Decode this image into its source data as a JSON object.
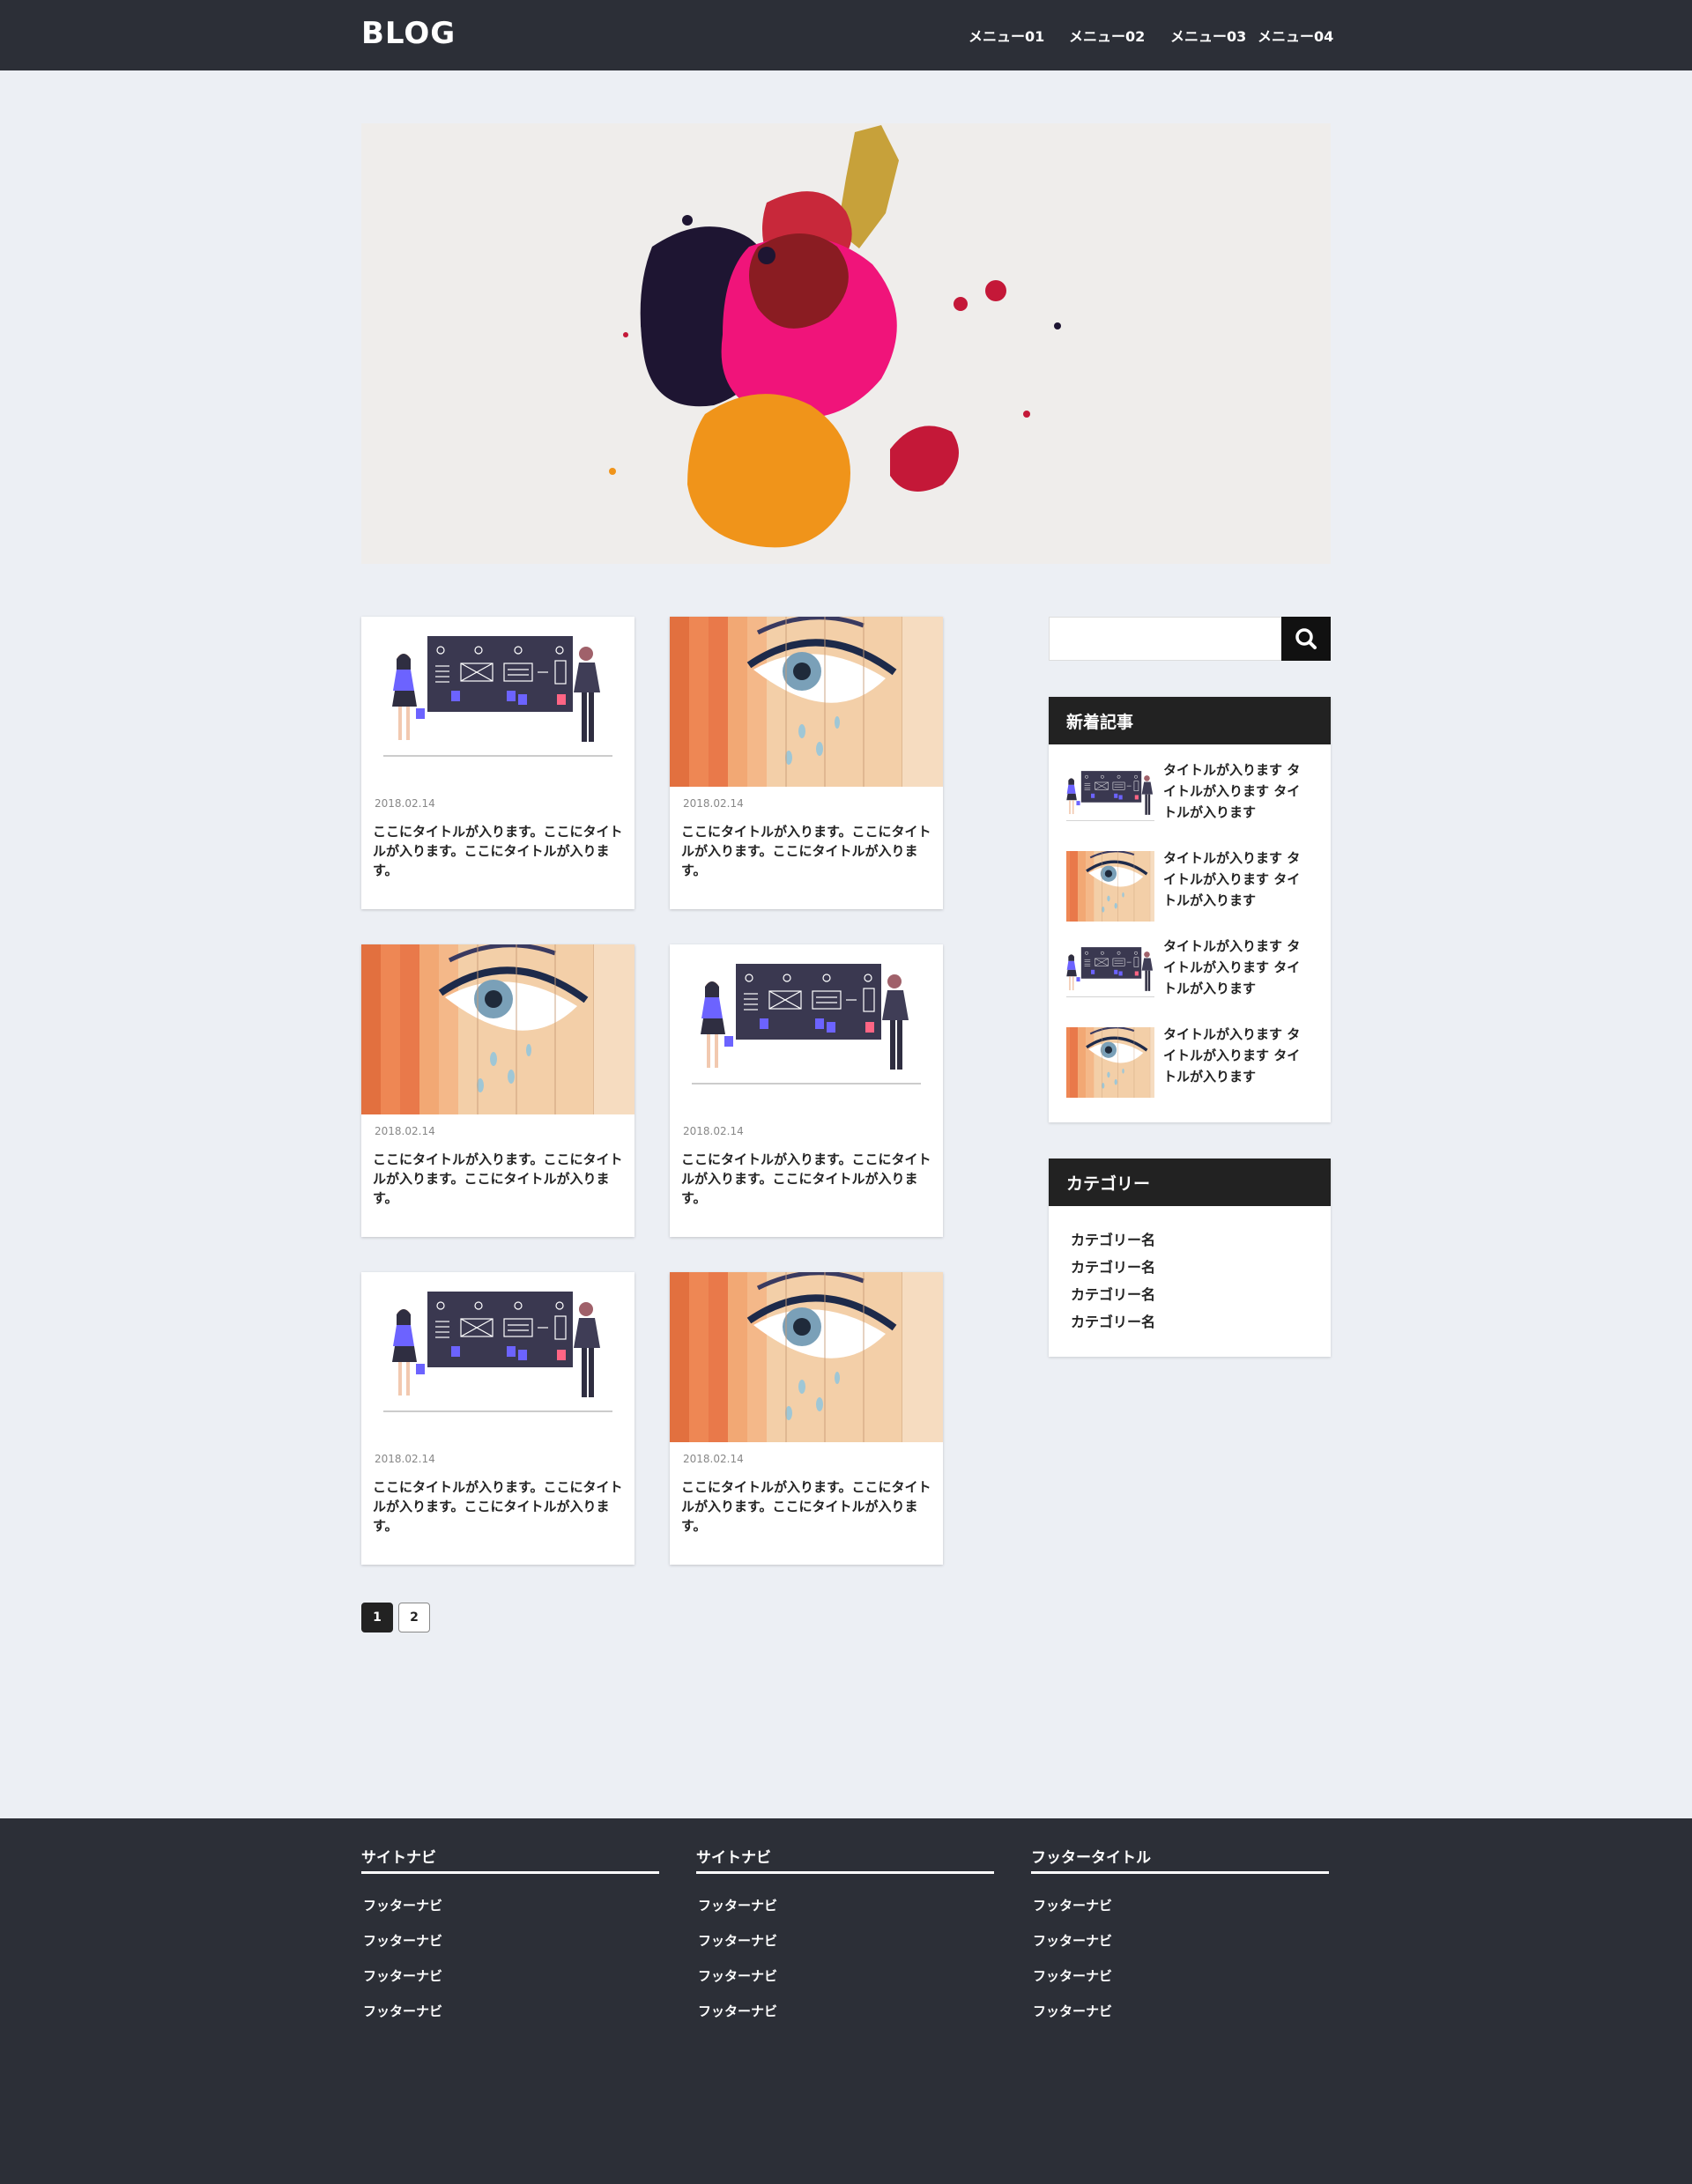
{
  "header": {
    "logo": "BLOG",
    "menu": [
      "メニュー01",
      "メニュー02",
      "メニュー03",
      "メニュー04"
    ]
  },
  "hero": {
    "image": "paint-splash-image"
  },
  "posts": [
    {
      "date": "2018.02.14",
      "title": "ここにタイトルが入ります。ここにタイトルが入ります。ここにタイトルが入ります。",
      "image": "wireframe-presentation-illustration"
    },
    {
      "date": "2018.02.14",
      "title": "ここにタイトルが入ります。ここにタイトルが入ります。ここにタイトルが入ります。",
      "image": "eye-mural-photo"
    },
    {
      "date": "2018.02.14",
      "title": "ここにタイトルが入ります。ここにタイトルが入ります。ここにタイトルが入ります。",
      "image": "eye-mural-photo"
    },
    {
      "date": "2018.02.14",
      "title": "ここにタイトルが入ります。ここにタイトルが入ります。ここにタイトルが入ります。",
      "image": "wireframe-presentation-illustration"
    },
    {
      "date": "2018.02.14",
      "title": "ここにタイトルが入ります。ここにタイトルが入ります。ここにタイトルが入ります。",
      "image": "wireframe-presentation-illustration"
    },
    {
      "date": "2018.02.14",
      "title": "ここにタイトルが入ります。ここにタイトルが入ります。ここにタイトルが入ります。",
      "image": "eye-mural-photo"
    }
  ],
  "pagination": {
    "pages": [
      "1",
      "2"
    ],
    "current": "1"
  },
  "sidebar": {
    "search": {
      "placeholder": "",
      "value": "",
      "icon": "search-icon"
    },
    "recent": {
      "heading": "新着記事",
      "items": [
        {
          "title": "タイトルが入ります タイトルが入ります タイトルが入ります",
          "image": "wireframe-presentation-illustration"
        },
        {
          "title": "タイトルが入ります タイトルが入ります タイトルが入ります",
          "image": "eye-mural-photo"
        },
        {
          "title": "タイトルが入ります タイトルが入ります タイトルが入ります",
          "image": "wireframe-presentation-illustration"
        },
        {
          "title": "タイトルが入ります タイトルが入ります タイトルが入ります",
          "image": "eye-mural-photo"
        }
      ]
    },
    "category": {
      "heading": "カテゴリー",
      "items": [
        "カテゴリー名",
        "カテゴリー名",
        "カテゴリー名",
        "カテゴリー名"
      ]
    }
  },
  "footer": {
    "columns": [
      {
        "title": "サイトナビ",
        "links": [
          "フッターナビ",
          "フッターナビ",
          "フッターナビ",
          "フッターナビ"
        ]
      },
      {
        "title": "サイトナビ",
        "links": [
          "フッターナビ",
          "フッターナビ",
          "フッターナビ",
          "フッターナビ"
        ]
      },
      {
        "title": "フッタータイトル",
        "links": [
          "フッターナビ",
          "フッターナビ",
          "フッターナビ",
          "フッターナビ"
        ]
      }
    ]
  },
  "colors": {
    "header_bg": "#2c2f37",
    "page_bg": "#eceff4",
    "widget_head_bg": "#222222",
    "footer_bg": "#2c2f37"
  }
}
